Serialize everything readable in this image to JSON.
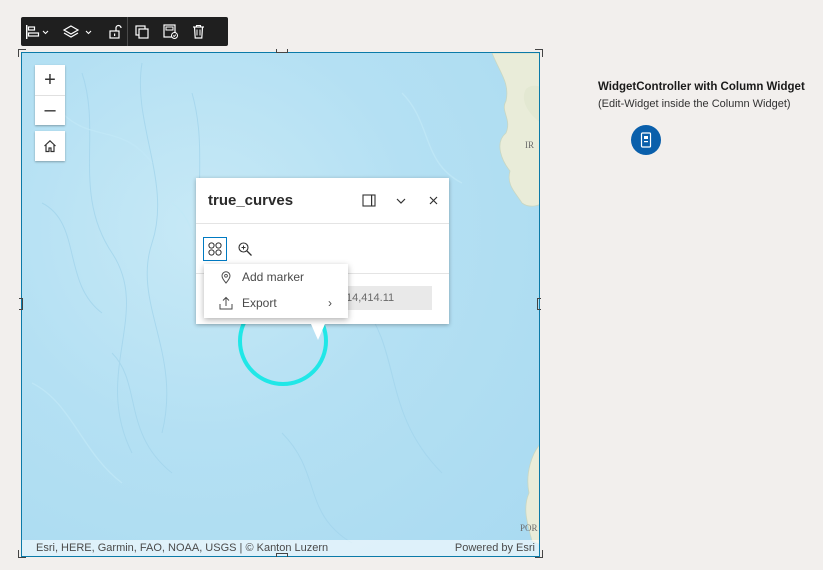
{
  "toolbar": {
    "items": [
      {
        "icon": "align-left-icon",
        "has_dropdown": true
      },
      {
        "icon": "layers-icon",
        "has_dropdown": true
      },
      {
        "icon": "unlock-icon"
      },
      {
        "icon": "duplicate-icon"
      },
      {
        "icon": "save-layout-icon"
      },
      {
        "icon": "trash-icon"
      }
    ]
  },
  "map": {
    "zoom_in_label": "+",
    "zoom_out_label": "–",
    "home_icon": "home-icon",
    "labels": {
      "ir": "IR",
      "por": "POR"
    },
    "attribution": {
      "left": "Esri, HERE, Garmin, FAO, NOAA, USGS | © Kanton Luzern",
      "right": "Powered by Esri"
    },
    "feature_color": "#20e7e7"
  },
  "popup": {
    "title": "true_curves",
    "dock_icon": "dock-icon",
    "collapse_icon": "chevron-down-icon",
    "close_icon": "close-icon",
    "actions": [
      {
        "icon": "grid-actions-icon",
        "active": true
      },
      {
        "icon": "zoom-to-icon",
        "active": false
      }
    ],
    "value_text": "14,414.11"
  },
  "action_menu": {
    "items": [
      {
        "label": "Add marker",
        "icon": "marker-icon"
      },
      {
        "label": "Export",
        "icon": "export-icon",
        "submenu": true
      }
    ],
    "submenu_chevron": "›"
  },
  "right_panel": {
    "title": "WidgetController with Column Widget",
    "subtitle": "(Edit-Widget inside the Column Widget)",
    "controller_icon": "widget-controller-icon",
    "accent": "#0a5fab"
  }
}
